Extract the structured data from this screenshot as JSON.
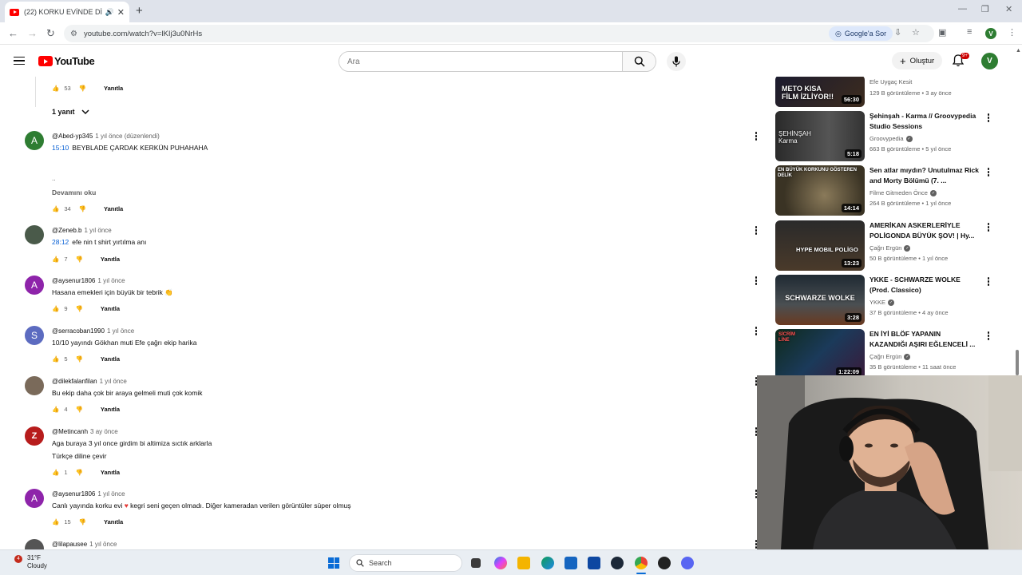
{
  "browser": {
    "tab_title": "(22) KORKU EVİNDE DİRİ DÜ...",
    "url": "youtube.com/watch?v=lKIj3u0NrHs",
    "google_lens_label": "Google'a Sor",
    "profile_initial": "V"
  },
  "header": {
    "logo_text": "YouTube",
    "search_placeholder": "Ara",
    "create_label": "Oluştur",
    "notif_count": "9+",
    "avatar_initial": "V"
  },
  "comments": {
    "top_reply": {
      "likes": "53",
      "reply_label": "Yanıtla"
    },
    "replies_toggle": "1 yanıt",
    "items": [
      {
        "initial": "A",
        "avatar_color": "#2e7d32",
        "handle": "@Abed-yp345",
        "time": "1 yıl önce (düzenlendi)",
        "timestamp": "15:10",
        "text": "BEYBLADE ÇARDAK KERKÜN  PUHAHAHA",
        "extra_line": "..",
        "read_more": "Devamını oku",
        "likes": "34",
        "reply_label": "Yanıtla"
      },
      {
        "initial": "",
        "avatar_color": "#4a5a4a",
        "handle": "@Zeneb.b",
        "time": "1 yıl önce",
        "timestamp": "28:12",
        "text": "efe nin t shirt yırtılma anı",
        "likes": "7",
        "reply_label": "Yanıtla"
      },
      {
        "initial": "A",
        "avatar_color": "#8e24aa",
        "handle": "@aysenur1806",
        "time": "1 yıl önce",
        "text": "Hasana emekleri için büyük bir tebrik 👏",
        "likes": "9",
        "reply_label": "Yanıtla"
      },
      {
        "initial": "S",
        "avatar_color": "#5c6bc0",
        "handle": "@serracoban1990",
        "time": "1 yıl önce",
        "text": "10/10  yayındı Gökhan muti Efe çağrı ekip harika",
        "likes": "5",
        "reply_label": "Yanıtla"
      },
      {
        "initial": "",
        "avatar_color": "#7a6a5a",
        "handle": "@dilekfalanfilan",
        "time": "1 yıl önce",
        "text": "Bu ekip daha çok bir araya gelmeli muti çok komik",
        "likes": "4",
        "reply_label": "Yanıtla"
      },
      {
        "initial": "",
        "avatar_color": "#b71c1c",
        "handle": "@Metincanh",
        "time": "3 ay önce",
        "text": "Aga buraya 3 yıl once girdim bi altimiza sıctık arklarla",
        "translate": "Türkçe diline çevir",
        "likes": "1",
        "reply_label": "Yanıtla"
      },
      {
        "initial": "A",
        "avatar_color": "#8e24aa",
        "handle": "@aysenur1806",
        "time": "1 yıl önce",
        "text_before": "Canlı yayında korku evi",
        "text_after": " kegri seni geçen olmadı. Diğer kameradan verilen görüntüler süper olmuş",
        "likes": "15",
        "reply_label": "Yanıtla"
      },
      {
        "initial": "",
        "avatar_color": "#555555",
        "handle": "@lilapausee",
        "time": "1 yıl önce"
      }
    ]
  },
  "sidebar": {
    "videos": [
      {
        "title": "",
        "channel": "Efe Uygaç Kesit",
        "views": "129 B görüntüleme",
        "age": "3 ay önce",
        "duration": "56:30",
        "thumb_text": "METO KISA FİLM İZLİYOR!!",
        "verified": false
      },
      {
        "title": "Şehinşah - Karma // Groovypedia Studio Sessions",
        "channel": "Groovypedia",
        "views": "663 B görüntüleme",
        "age": "5 yıl önce",
        "duration": "5:18",
        "thumb_text": "ŞEHİNŞAH Karma",
        "verified": true
      },
      {
        "title": "Sen atlar mıydın? Unutulmaz Rick and Morty Bölümü (7. ...",
        "channel": "Filme Gitmeden Önce",
        "views": "264 B görüntüleme",
        "age": "1 yıl önce",
        "duration": "14:14",
        "thumb_text": "EN BÜYÜK KORKUNU GÖSTEREN DELİK",
        "verified": true
      },
      {
        "title": "AMERİKAN ASKERLERİYLE POLİGONDA BÜYÜK ŞOV! | Hy...",
        "channel": "Çağrı Ergün",
        "views": "50 B görüntüleme",
        "age": "1 yıl önce",
        "duration": "13:23",
        "thumb_text": "HYPE MOBIL POLİGO",
        "verified": true
      },
      {
        "title": "YKKE - SCHWARZE WOLKE (Prod. Classico)",
        "channel": "YKKE",
        "views": "37 B görüntüleme",
        "age": "4 ay önce",
        "duration": "3:28",
        "thumb_text": "SCHWARZE WOLKE",
        "verified": true
      },
      {
        "title": "EN İYİ BLÖF YAPANIN KAZANDIĞI AŞIRI EĞLENCELİ ...",
        "channel": "Çağrı Ergün",
        "views": "35 B görüntüleme",
        "age": "11 saat önce",
        "duration": "1:22:09",
        "thumb_text": "SİCRİM LİNE",
        "verified": true
      }
    ]
  },
  "taskbar": {
    "weather_badge": "4",
    "temp": "31°F",
    "condition": "Cloudy",
    "search_label": "Search"
  }
}
